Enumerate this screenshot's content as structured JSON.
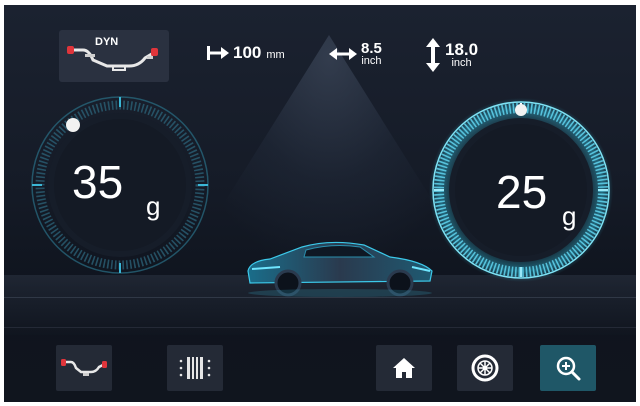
{
  "header": {
    "mode_label": "DYN",
    "offset": {
      "value": "100",
      "unit": "mm"
    },
    "width": {
      "value": "8.5",
      "unit": "inch"
    },
    "diameter": {
      "value": "18.0",
      "unit": "inch"
    }
  },
  "gauges": {
    "left": {
      "value": "35",
      "unit": "g"
    },
    "right": {
      "value": "25",
      "unit": "g"
    }
  },
  "toolbar": {
    "icons": [
      "rim-profile-icon",
      "tire-tread-icon",
      "home-icon",
      "wheel-icon",
      "zoom-in-icon"
    ]
  },
  "colors": {
    "accent": "#35c7e6",
    "background": "#151b27",
    "highlight_tile": "#1f5767"
  }
}
